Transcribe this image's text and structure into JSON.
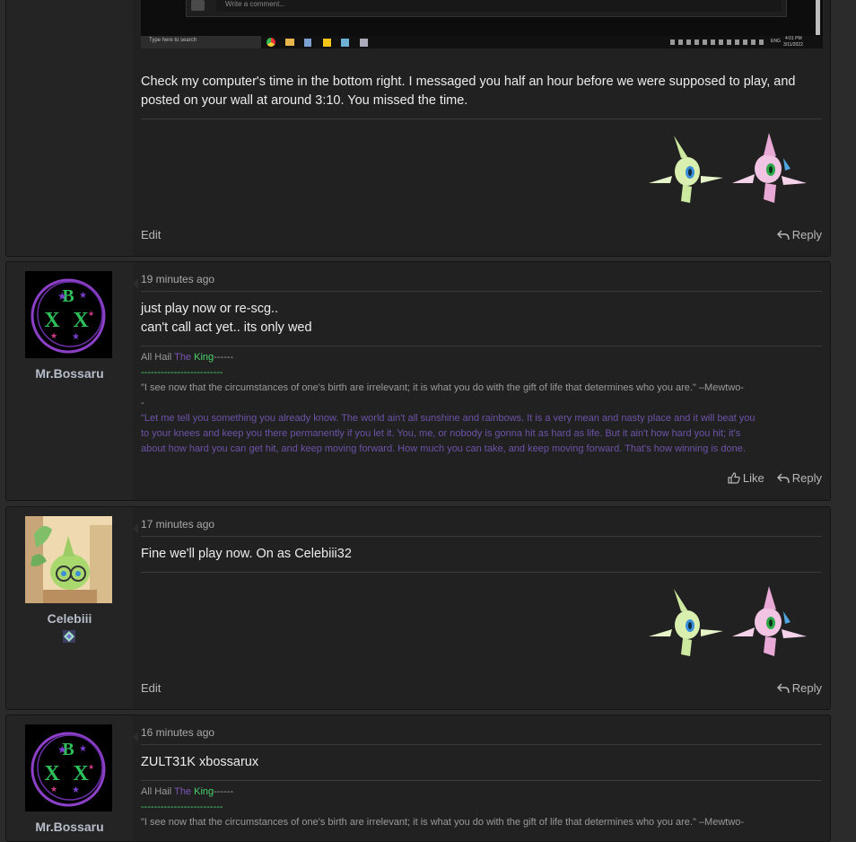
{
  "first_post": {
    "screenshot_comment_placeholder": "Write a comment...",
    "taskbar_search": "Type here to search",
    "taskbar_lang": "ENG",
    "taskbar_time": "4:01 PM",
    "taskbar_date": "3/11/2022",
    "message_lines": [
      "Check my computer's time in the bottom right. I messaged you half an hour before we were supposed to play, and",
      "posted on your wall at around 3:10. You missed the time."
    ],
    "edit_label": "Edit",
    "reply_label": "Reply"
  },
  "posts": [
    {
      "username": "Mr.Bossaru",
      "time": "19 minutes ago",
      "message_lines": [
        "just play now or re-scg..",
        "can't call act yet.. its only wed"
      ],
      "like_label": "Like",
      "reply_label": "Reply"
    },
    {
      "username": "Celebiii",
      "time": "17 minutes ago",
      "message_lines": [
        "Fine we'll play now. On as Celebiii32"
      ],
      "edit_label": "Edit",
      "reply_label": "Reply"
    },
    {
      "username": "Mr.Bossaru",
      "time": "16 minutes ago",
      "message_lines": [
        "ZULT31K xbossarux"
      ]
    }
  ],
  "signature": {
    "prefix": "All Hail ",
    "the": "The",
    "king": "King",
    "dash_tail": "------",
    "dash_line": "-------------------------",
    "quote1_a": "\"I see now that the circumstances of one's birth are irrelevant; it is what you do with the gift of life that determines who you are.\" –Mewtwo-",
    "quote1_b": "-",
    "quote2_lines": [
      "\"Let me tell you something you already know. The world ain't all sunshine and rainbows. It is a very mean and nasty place and it will beat you",
      "to your knees and keep you there permanently if you let it. You, me, or nobody is gonna hit as hard as life. But it ain't how hard you hit; it's",
      "about how hard you can get hit, and keep moving forward. How much you can take, and keep moving forward. That's how winning is done."
    ]
  },
  "colors": {
    "bg": "#2b2b2b",
    "post_bg": "#212121",
    "username": "#b7bdc9",
    "sig_purple": "#7a55b5",
    "sig_green": "#4bd26b"
  }
}
